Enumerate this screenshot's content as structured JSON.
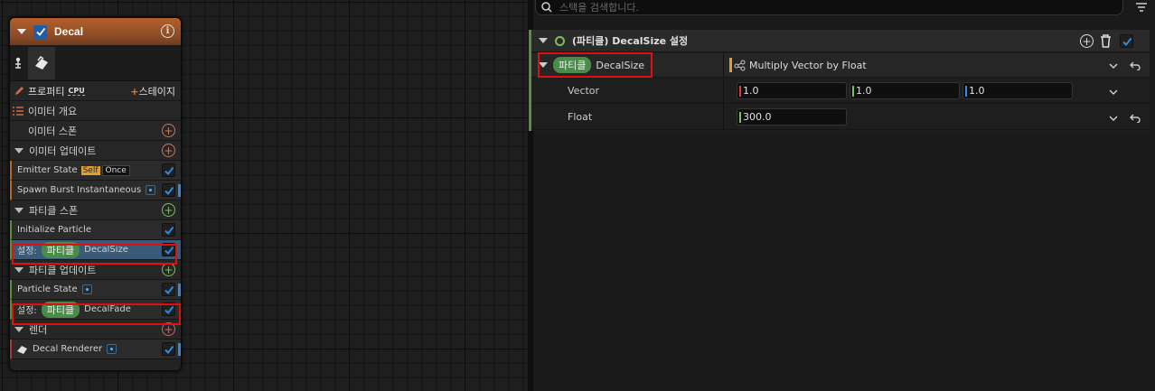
{
  "colors": {
    "accent_blue": "#2f8ae0",
    "header_orange": "#b4602b",
    "pill_green": "#4a8a4a",
    "highlight_red": "#e01010"
  },
  "node": {
    "title": "Decal",
    "props_label": "프로퍼티",
    "cpu_label": "CPU",
    "stage_label": "스테이지",
    "emitter_summary": "이미터 개요",
    "emitter_spawn": "이미터 스폰",
    "emitter_update": "이미터 업데이트",
    "emitter_state": "Emitter State",
    "badge_self": "Self",
    "badge_once": "Once",
    "spawn_burst": "Spawn Burst Instantaneous",
    "particle_spawn": "파티클 스폰",
    "initialize_particle": "Initialize Particle",
    "set_prefix": "설정:",
    "particle_pill": "파티클",
    "decal_size": "DecalSize",
    "particle_update": "파티클 업데이트",
    "particle_state": "Particle State",
    "decal_fade": "DecalFade",
    "render": "렌더",
    "decal_renderer": "Decal Renderer"
  },
  "right": {
    "search_placeholder": "스택을 검색합니다.",
    "title": "(파티클) DecalSize 설정",
    "param_pill": "파티클",
    "param_name": "DecalSize",
    "dynamic_input": "Multiply Vector by Float",
    "vector_label": "Vector",
    "vector_x": "1.0",
    "vector_y": "1.0",
    "vector_z": "1.0",
    "float_label": "Float",
    "float_value": "300.0"
  }
}
